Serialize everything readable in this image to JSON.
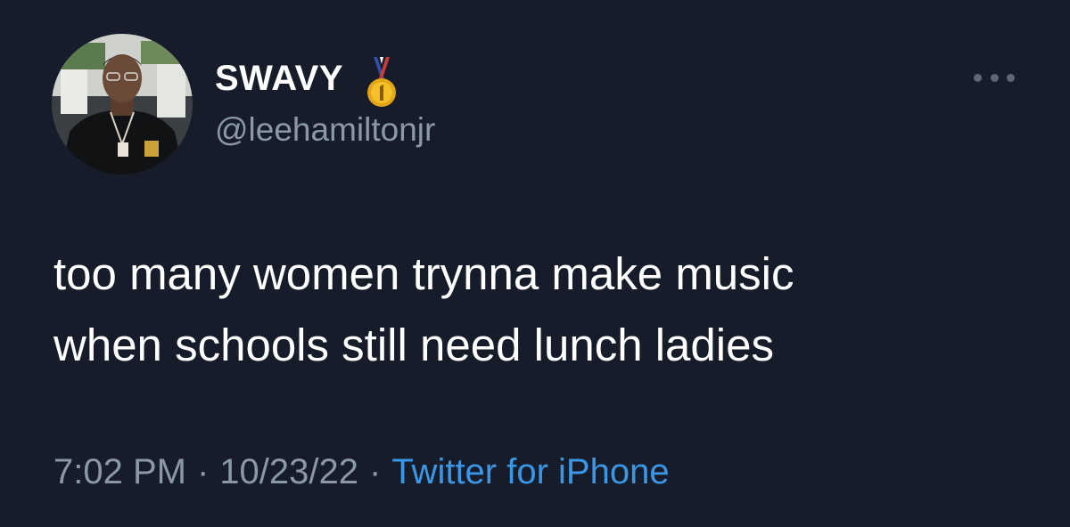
{
  "author": {
    "display_name": "SWAVY",
    "badge_icon": "medal-icon",
    "handle": "@leehamiltonjr",
    "avatar_icon": "avatar"
  },
  "menu": {
    "more_icon": "more-horizontal-icon"
  },
  "tweet": {
    "lines": [
      "too many women trynna make music",
      "when schools still need lunch ladies"
    ]
  },
  "meta": {
    "time": "7:02 PM",
    "date": "10/23/22",
    "separator": "·",
    "source": "Twitter for iPhone"
  },
  "colors": {
    "background": "#161c29",
    "text_primary": "#ffffff",
    "text_secondary": "#8b98a5",
    "link": "#3b97e6"
  }
}
